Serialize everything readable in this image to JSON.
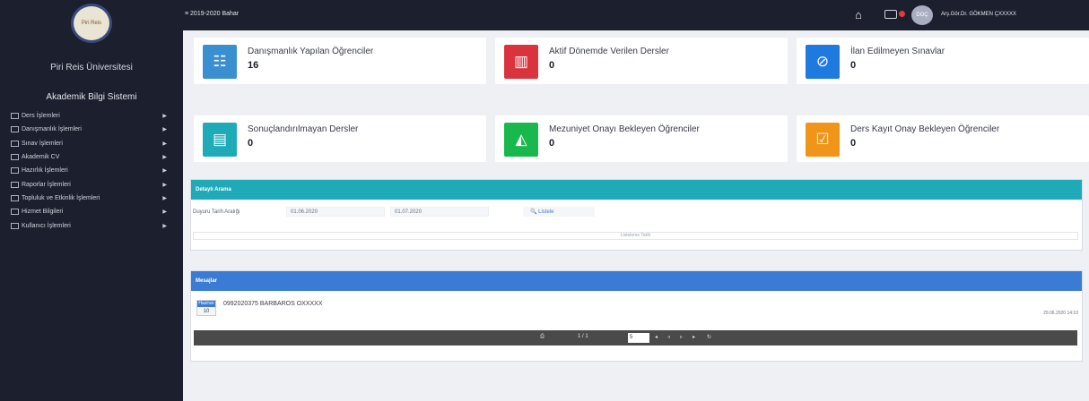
{
  "sidebar": {
    "logo_text": "Piri Reis",
    "university": "Piri Reis Üniversitesi",
    "system_title": "Akademik Bilgi Sistemi",
    "items": [
      {
        "label": "Ders İşlemleri"
      },
      {
        "label": "Danışmanlık İşlemleri"
      },
      {
        "label": "Sınav İşlemleri"
      },
      {
        "label": "Akademik CV"
      },
      {
        "label": "Hazırlık İşlemleri"
      },
      {
        "label": "Raporlar İşlemleri"
      },
      {
        "label": "Topluluk ve Etkinlik İşlemleri"
      },
      {
        "label": "Hizmet Bilgileri"
      },
      {
        "label": "Kullanıcı İşlemleri"
      }
    ]
  },
  "topbar": {
    "term": "≡ 2019-2020 Bahar",
    "avatar_initials": "DOÇ",
    "user": "Arş.Gör.Dr. GÖKMEN ÇXXXXX"
  },
  "cards": [
    {
      "title": "Danışmanlık Yapılan Öğrenciler",
      "value": "16",
      "color": "#3a8fd0",
      "icon": "users-icon",
      "glyph": "☷"
    },
    {
      "title": "Aktif Dönemde Verilen Dersler",
      "value": "0",
      "color": "#d9343e",
      "icon": "books-icon",
      "glyph": "▥"
    },
    {
      "title": "İlan Edilmeyen Sınavlar",
      "value": "0",
      "color": "#1f7ae0",
      "icon": "exam-icon",
      "glyph": "⊘"
    },
    {
      "title": "Sonuçlandırılmayan Dersler",
      "value": "0",
      "color": "#1faab8",
      "icon": "clipboard-icon",
      "glyph": "▤"
    },
    {
      "title": "Mezuniyet Onayı Bekleyen Öğrenciler",
      "value": "0",
      "color": "#19b84c",
      "icon": "graduation-cap-icon",
      "glyph": "◭"
    },
    {
      "title": "Ders Kayıt Onay Bekleyen Öğrenciler",
      "value": "0",
      "color": "#f0941a",
      "icon": "check-clipboard-icon",
      "glyph": "☑"
    }
  ],
  "filter_panel": {
    "title": "Detaylı Arama",
    "range_label": "Duyuru Tarih Aralığı",
    "date_from": "01.06.2020",
    "date_to": "01.07.2020",
    "search_label": "🔍 Listele",
    "bar_text": "Listeleme Tarih"
  },
  "messages_panel": {
    "title": "Mesajlar",
    "badge_top": "Haziran",
    "badge_day": "10",
    "message": "0992020375 BARBAROS OXXXXX",
    "date": "29.06.2020 14:10",
    "pager_info": "1 / 1",
    "page_size": "5"
  }
}
